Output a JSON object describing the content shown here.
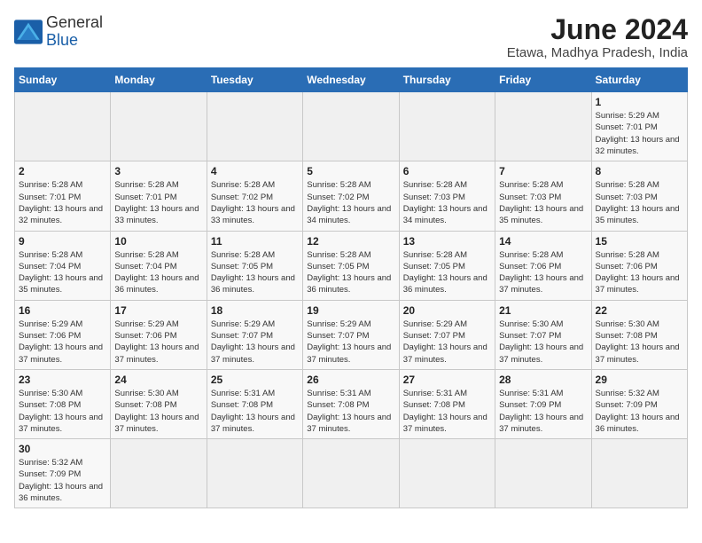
{
  "logo": {
    "text_general": "General",
    "text_blue": "Blue"
  },
  "header": {
    "month_year": "June 2024",
    "location": "Etawa, Madhya Pradesh, India"
  },
  "weekdays": [
    "Sunday",
    "Monday",
    "Tuesday",
    "Wednesday",
    "Thursday",
    "Friday",
    "Saturday"
  ],
  "days": [
    {
      "num": "",
      "info": ""
    },
    {
      "num": "",
      "info": ""
    },
    {
      "num": "",
      "info": ""
    },
    {
      "num": "",
      "info": ""
    },
    {
      "num": "",
      "info": ""
    },
    {
      "num": "",
      "info": ""
    },
    {
      "num": "1",
      "info": "Sunrise: 5:29 AM\nSunset: 7:01 PM\nDaylight: 13 hours and 32 minutes."
    },
    {
      "num": "2",
      "info": "Sunrise: 5:28 AM\nSunset: 7:01 PM\nDaylight: 13 hours and 32 minutes."
    },
    {
      "num": "3",
      "info": "Sunrise: 5:28 AM\nSunset: 7:01 PM\nDaylight: 13 hours and 33 minutes."
    },
    {
      "num": "4",
      "info": "Sunrise: 5:28 AM\nSunset: 7:02 PM\nDaylight: 13 hours and 33 minutes."
    },
    {
      "num": "5",
      "info": "Sunrise: 5:28 AM\nSunset: 7:02 PM\nDaylight: 13 hours and 34 minutes."
    },
    {
      "num": "6",
      "info": "Sunrise: 5:28 AM\nSunset: 7:03 PM\nDaylight: 13 hours and 34 minutes."
    },
    {
      "num": "7",
      "info": "Sunrise: 5:28 AM\nSunset: 7:03 PM\nDaylight: 13 hours and 35 minutes."
    },
    {
      "num": "8",
      "info": "Sunrise: 5:28 AM\nSunset: 7:03 PM\nDaylight: 13 hours and 35 minutes."
    },
    {
      "num": "9",
      "info": "Sunrise: 5:28 AM\nSunset: 7:04 PM\nDaylight: 13 hours and 35 minutes."
    },
    {
      "num": "10",
      "info": "Sunrise: 5:28 AM\nSunset: 7:04 PM\nDaylight: 13 hours and 36 minutes."
    },
    {
      "num": "11",
      "info": "Sunrise: 5:28 AM\nSunset: 7:05 PM\nDaylight: 13 hours and 36 minutes."
    },
    {
      "num": "12",
      "info": "Sunrise: 5:28 AM\nSunset: 7:05 PM\nDaylight: 13 hours and 36 minutes."
    },
    {
      "num": "13",
      "info": "Sunrise: 5:28 AM\nSunset: 7:05 PM\nDaylight: 13 hours and 36 minutes."
    },
    {
      "num": "14",
      "info": "Sunrise: 5:28 AM\nSunset: 7:06 PM\nDaylight: 13 hours and 37 minutes."
    },
    {
      "num": "15",
      "info": "Sunrise: 5:28 AM\nSunset: 7:06 PM\nDaylight: 13 hours and 37 minutes."
    },
    {
      "num": "16",
      "info": "Sunrise: 5:29 AM\nSunset: 7:06 PM\nDaylight: 13 hours and 37 minutes."
    },
    {
      "num": "17",
      "info": "Sunrise: 5:29 AM\nSunset: 7:06 PM\nDaylight: 13 hours and 37 minutes."
    },
    {
      "num": "18",
      "info": "Sunrise: 5:29 AM\nSunset: 7:07 PM\nDaylight: 13 hours and 37 minutes."
    },
    {
      "num": "19",
      "info": "Sunrise: 5:29 AM\nSunset: 7:07 PM\nDaylight: 13 hours and 37 minutes."
    },
    {
      "num": "20",
      "info": "Sunrise: 5:29 AM\nSunset: 7:07 PM\nDaylight: 13 hours and 37 minutes."
    },
    {
      "num": "21",
      "info": "Sunrise: 5:30 AM\nSunset: 7:07 PM\nDaylight: 13 hours and 37 minutes."
    },
    {
      "num": "22",
      "info": "Sunrise: 5:30 AM\nSunset: 7:08 PM\nDaylight: 13 hours and 37 minutes."
    },
    {
      "num": "23",
      "info": "Sunrise: 5:30 AM\nSunset: 7:08 PM\nDaylight: 13 hours and 37 minutes."
    },
    {
      "num": "24",
      "info": "Sunrise: 5:30 AM\nSunset: 7:08 PM\nDaylight: 13 hours and 37 minutes."
    },
    {
      "num": "25",
      "info": "Sunrise: 5:31 AM\nSunset: 7:08 PM\nDaylight: 13 hours and 37 minutes."
    },
    {
      "num": "26",
      "info": "Sunrise: 5:31 AM\nSunset: 7:08 PM\nDaylight: 13 hours and 37 minutes."
    },
    {
      "num": "27",
      "info": "Sunrise: 5:31 AM\nSunset: 7:08 PM\nDaylight: 13 hours and 37 minutes."
    },
    {
      "num": "28",
      "info": "Sunrise: 5:31 AM\nSunset: 7:09 PM\nDaylight: 13 hours and 37 minutes."
    },
    {
      "num": "29",
      "info": "Sunrise: 5:32 AM\nSunset: 7:09 PM\nDaylight: 13 hours and 36 minutes."
    },
    {
      "num": "30",
      "info": "Sunrise: 5:32 AM\nSunset: 7:09 PM\nDaylight: 13 hours and 36 minutes."
    }
  ]
}
